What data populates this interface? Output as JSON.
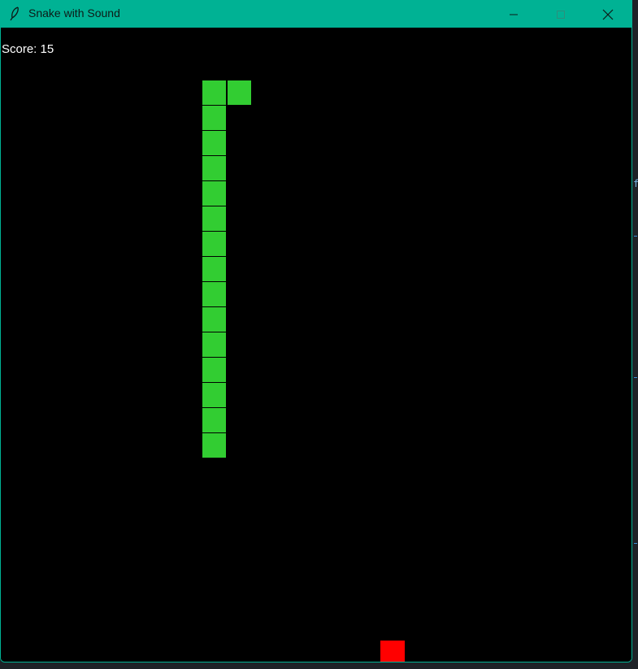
{
  "window": {
    "title": "Snake with Sound",
    "titlebar_color": "#00b294",
    "controls": [
      "minimize-icon",
      "maximize-icon",
      "close-icon"
    ]
  },
  "game": {
    "score_text": "Score: 15",
    "background_color": "#000000",
    "snake_color": "#32cd32",
    "food_color": "#ff0000",
    "grid_cell": 31,
    "snake": [
      {
        "col": 9,
        "row": 2
      },
      {
        "col": 8,
        "row": 2
      },
      {
        "col": 8,
        "row": 3
      },
      {
        "col": 8,
        "row": 4
      },
      {
        "col": 8,
        "row": 5
      },
      {
        "col": 8,
        "row": 6
      },
      {
        "col": 8,
        "row": 7
      },
      {
        "col": 8,
        "row": 8
      },
      {
        "col": 8,
        "row": 9
      },
      {
        "col": 8,
        "row": 10
      },
      {
        "col": 8,
        "row": 11
      },
      {
        "col": 8,
        "row": 12
      },
      {
        "col": 8,
        "row": 13
      },
      {
        "col": 8,
        "row": 14
      },
      {
        "col": 8,
        "row": 15
      },
      {
        "col": 8,
        "row": 16
      }
    ],
    "food": {
      "col": 15,
      "row": 24
    }
  },
  "background_glyph": "f"
}
